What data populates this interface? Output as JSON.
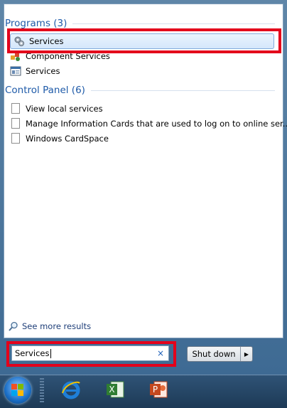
{
  "results": {
    "programs": {
      "header": "Programs (3)",
      "items": [
        {
          "label": "Services",
          "icon": "gears-icon",
          "selected": true
        },
        {
          "label": "Component Services",
          "icon": "component-services-icon"
        },
        {
          "label": "Services",
          "icon": "console-icon"
        }
      ]
    },
    "control_panel": {
      "header": "Control Panel (6)",
      "items": [
        {
          "label": "View local services",
          "icon": "document-icon"
        },
        {
          "label": "Manage Information Cards that are used to log on to online ser...",
          "icon": "document-icon"
        },
        {
          "label": "Windows CardSpace",
          "icon": "document-icon"
        }
      ]
    },
    "see_more": "See more results"
  },
  "search": {
    "value": "Services",
    "clear_glyph": "×"
  },
  "shutdown": {
    "label": "Shut down",
    "arrow_glyph": "▶"
  },
  "taskbar": {
    "pinned": [
      "internet-explorer-icon",
      "excel-icon",
      "powerpoint-icon"
    ]
  },
  "colors": {
    "highlight": "#e3001b",
    "header_text": "#1e5aa8"
  }
}
